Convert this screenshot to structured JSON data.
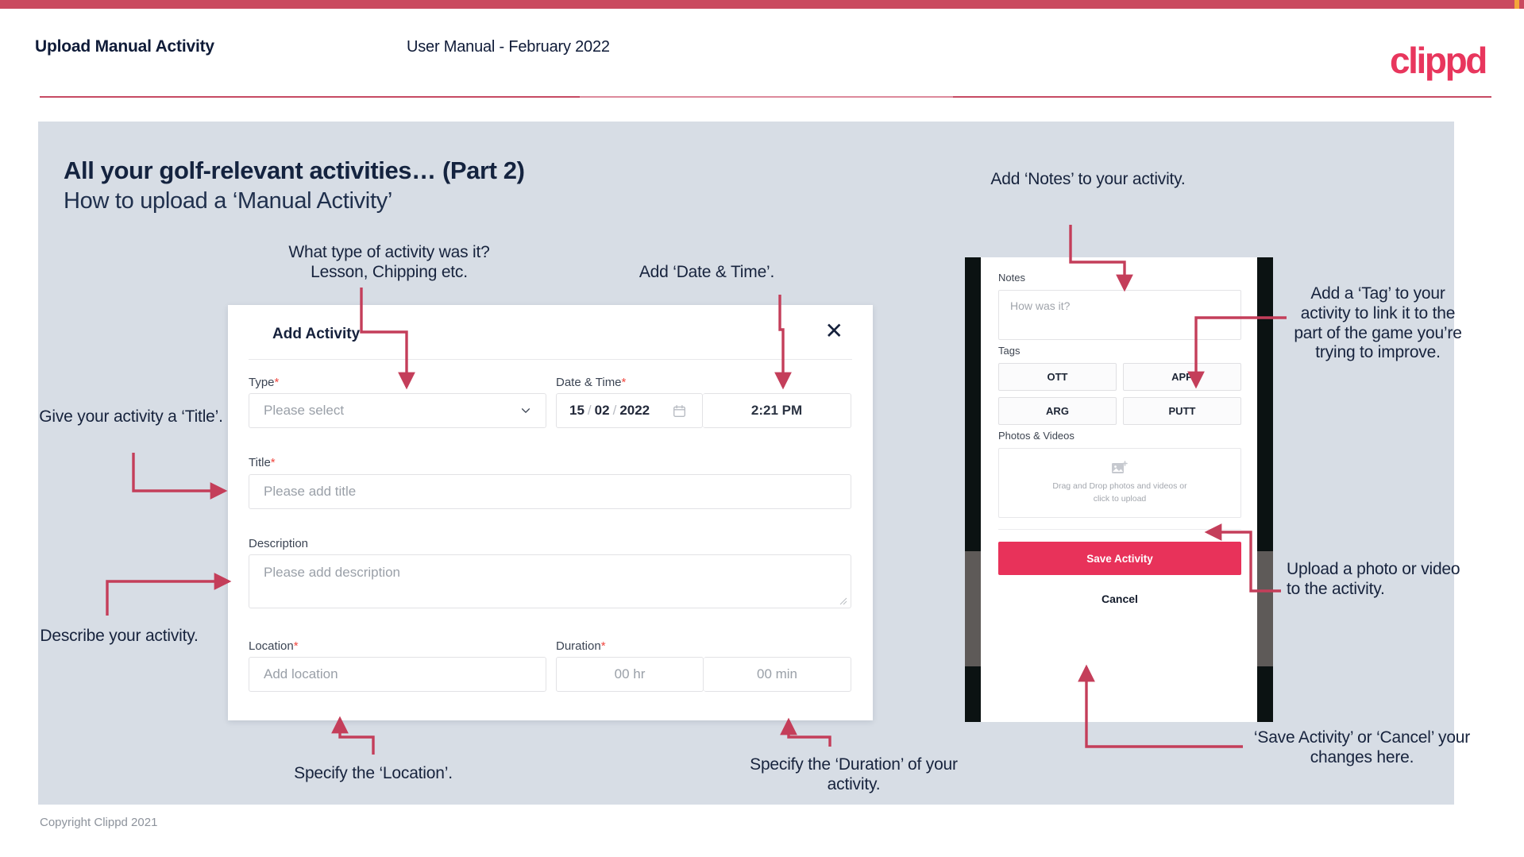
{
  "brand": {
    "name": "clippd",
    "accent": "#e8365d",
    "bar_color": "#ca4a5f",
    "panel_bg": "#d7dde5"
  },
  "header": {
    "left_title": "Upload Manual Activity",
    "center_title": "User Manual - February 2022",
    "logo_text": "clippd"
  },
  "slide": {
    "title": "All your golf-relevant activities… (Part 2)",
    "subtitle": "How to upload a ‘Manual Activity’"
  },
  "dialog": {
    "title": "Add Activity",
    "close_icon": "close-icon",
    "fields": {
      "type": {
        "label": "Type",
        "required": "*",
        "placeholder": "Please select",
        "chevron": "chevron-down-icon"
      },
      "date_time": {
        "label": "Date & Time",
        "required": "*",
        "day": "15",
        "sep1": "/",
        "month": "02",
        "sep2": "/",
        "year": "2022",
        "calendar_icon": "calendar-icon",
        "time": "2:21 PM"
      },
      "title": {
        "label": "Title",
        "required": "*",
        "placeholder": "Please add title"
      },
      "description": {
        "label": "Description",
        "placeholder": "Please add description"
      },
      "location": {
        "label": "Location",
        "required": "*",
        "placeholder": "Add location"
      },
      "duration": {
        "label": "Duration",
        "required": "*",
        "hours": "00 hr",
        "minutes": "00 min"
      }
    }
  },
  "phone": {
    "notes": {
      "label": "Notes",
      "placeholder": "How was it?"
    },
    "tags": {
      "label": "Tags",
      "items": [
        "OTT",
        "APP",
        "ARG",
        "PUTT"
      ]
    },
    "photos": {
      "label": "Photos & Videos",
      "icon": "add-image-icon",
      "line1": "Drag and Drop photos and videos or",
      "line2": "click to upload"
    },
    "save_label": "Save Activity",
    "cancel_label": "Cancel",
    "save_color": "#e8325a"
  },
  "annotations": {
    "type": "What type of activity was it? Lesson, Chipping etc.",
    "date_time": "Add ‘Date & Time’.",
    "title": "Give your activity a ‘Title’.",
    "description": "Describe your activity.",
    "location": "Specify the ‘Location’.",
    "duration": "Specify the ‘Duration’ of your activity.",
    "notes": "Add ‘Notes’ to your activity.",
    "tag": "Add a ‘Tag’ to your activity to link it to the part of the game you’re trying to improve.",
    "upload": "Upload a photo or video to the activity.",
    "save": "‘Save Activity’ or ‘Cancel’ your changes here."
  },
  "footer": {
    "copyright": "Copyright Clippd 2021"
  }
}
